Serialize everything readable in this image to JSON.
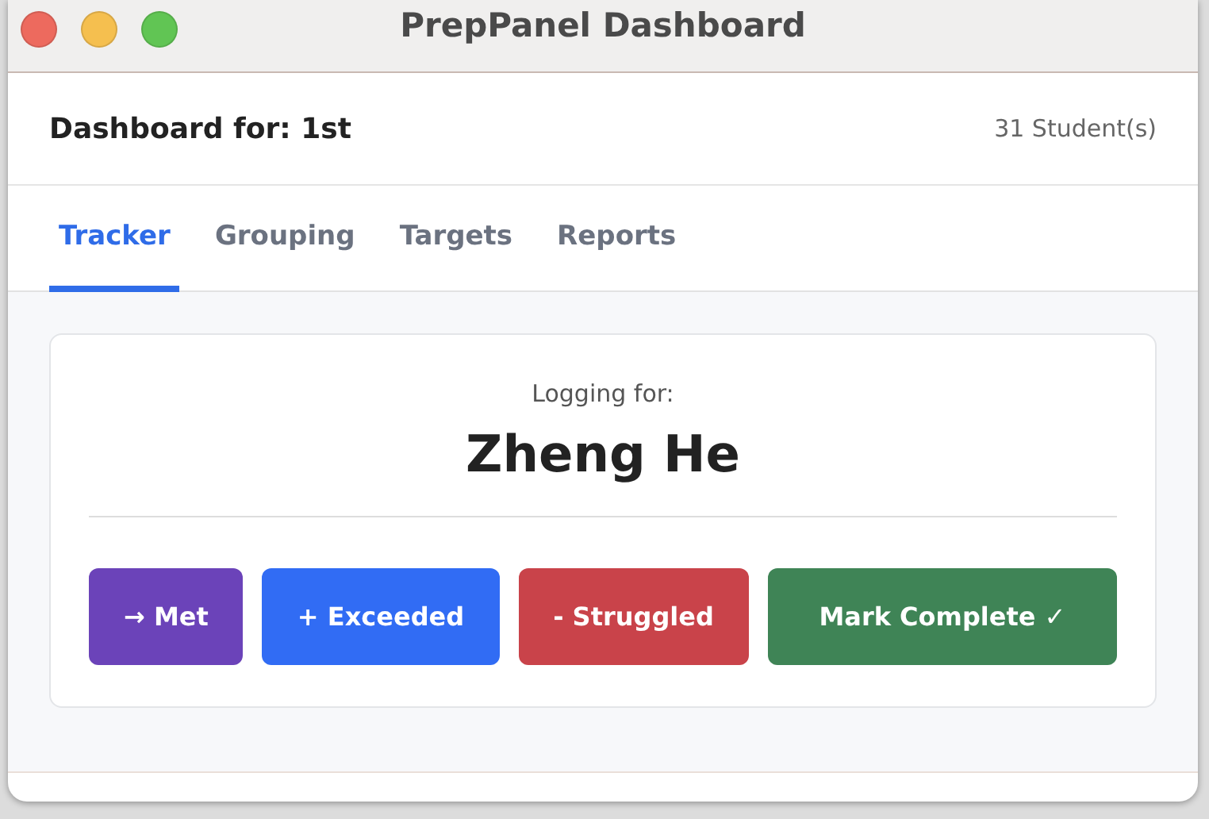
{
  "window": {
    "title": "PrepPanel Dashboard"
  },
  "header": {
    "title": "Dashboard for: 1st",
    "student_count": "31 Student(s)"
  },
  "tabs": [
    {
      "label": "Tracker",
      "selected": true
    },
    {
      "label": "Grouping",
      "selected": false
    },
    {
      "label": "Targets",
      "selected": false
    },
    {
      "label": "Reports",
      "selected": false
    }
  ],
  "tracker": {
    "caption": "Logging for:",
    "student": "Zheng He",
    "buttons": [
      {
        "label": "→ Met",
        "color": "#6b43b9"
      },
      {
        "label": "+ Exceeded",
        "color": "#316cf4"
      },
      {
        "label": "- Struggled",
        "color": "#c9434a"
      },
      {
        "label": "Mark Complete ✓",
        "color": "#3f8456"
      }
    ]
  }
}
